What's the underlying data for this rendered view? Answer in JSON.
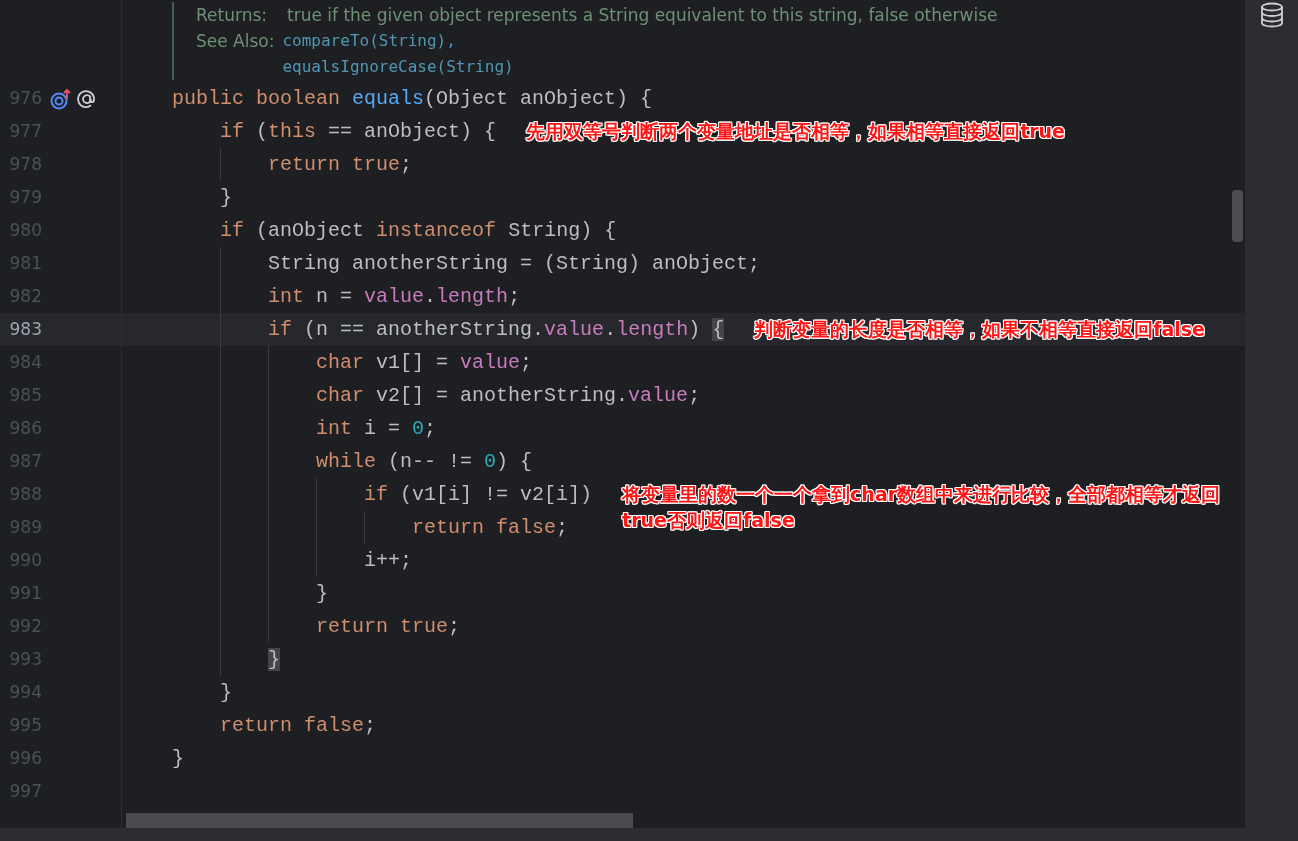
{
  "doc": {
    "returns_label": "Returns:",
    "returns_text": "true if the given object represents a String equivalent to this string, false otherwise",
    "see_also_label": "See Also:",
    "links": [
      "compareTo(String),",
      "equalsIgnoreCase(String)"
    ]
  },
  "lines": [
    {
      "number": "976",
      "current": false,
      "gutter_icons": true,
      "tokens": [
        {
          "kind": "keyword",
          "text": "    public boolean "
        },
        {
          "kind": "method",
          "text": "equals"
        },
        {
          "kind": "plain",
          "text": "(Object anObject) {"
        }
      ]
    },
    {
      "number": "977",
      "current": false,
      "tokens": [
        {
          "kind": "keyword",
          "text": "        if"
        },
        {
          "kind": "plain",
          "text": " ("
        },
        {
          "kind": "keyword",
          "text": "this"
        },
        {
          "kind": "plain",
          "text": " == anObject) {"
        }
      ],
      "note": "先用双等号判断两个变量地址是否相等，如果相等直接返回true"
    },
    {
      "number": "978",
      "current": false,
      "tokens": [
        {
          "kind": "keyword",
          "text": "            return true"
        },
        {
          "kind": "plain",
          "text": ";"
        }
      ]
    },
    {
      "number": "979",
      "current": false,
      "tokens": [
        {
          "kind": "plain",
          "text": "        }"
        }
      ]
    },
    {
      "number": "980",
      "current": false,
      "tokens": [
        {
          "kind": "keyword",
          "text": "        if"
        },
        {
          "kind": "plain",
          "text": " (anObject "
        },
        {
          "kind": "keyword",
          "text": "instanceof"
        },
        {
          "kind": "plain",
          "text": " String) {"
        }
      ]
    },
    {
      "number": "981",
      "current": false,
      "tokens": [
        {
          "kind": "plain",
          "text": "            String anotherString = (String) anObject;"
        }
      ]
    },
    {
      "number": "982",
      "current": false,
      "tokens": [
        {
          "kind": "keyword",
          "text": "            int"
        },
        {
          "kind": "plain",
          "text": " n = "
        },
        {
          "kind": "field",
          "text": "value"
        },
        {
          "kind": "plain",
          "text": "."
        },
        {
          "kind": "field",
          "text": "length"
        },
        {
          "kind": "plain",
          "text": ";"
        }
      ]
    },
    {
      "number": "983",
      "current": true,
      "tokens": [
        {
          "kind": "keyword",
          "text": "            if"
        },
        {
          "kind": "plain",
          "text": " (n == anotherString."
        },
        {
          "kind": "field",
          "text": "value"
        },
        {
          "kind": "plain",
          "text": "."
        },
        {
          "kind": "field",
          "text": "length"
        },
        {
          "kind": "plain",
          "text": ") "
        },
        {
          "kind": "match",
          "text": "{"
        }
      ],
      "note": "判断变量的长度是否相等，如果不相等直接返回false"
    },
    {
      "number": "984",
      "current": false,
      "tokens": [
        {
          "kind": "keyword",
          "text": "                char"
        },
        {
          "kind": "plain",
          "text": " v1[] = "
        },
        {
          "kind": "field",
          "text": "value"
        },
        {
          "kind": "plain",
          "text": ";"
        }
      ]
    },
    {
      "number": "985",
      "current": false,
      "tokens": [
        {
          "kind": "keyword",
          "text": "                char"
        },
        {
          "kind": "plain",
          "text": " v2[] = anotherString."
        },
        {
          "kind": "field",
          "text": "value"
        },
        {
          "kind": "plain",
          "text": ";"
        }
      ]
    },
    {
      "number": "986",
      "current": false,
      "tokens": [
        {
          "kind": "keyword",
          "text": "                int"
        },
        {
          "kind": "plain",
          "text": " i = "
        },
        {
          "kind": "number",
          "text": "0"
        },
        {
          "kind": "plain",
          "text": ";"
        }
      ]
    },
    {
      "number": "987",
      "current": false,
      "tokens": [
        {
          "kind": "keyword",
          "text": "                while"
        },
        {
          "kind": "plain",
          "text": " (n-- != "
        },
        {
          "kind": "number",
          "text": "0"
        },
        {
          "kind": "plain",
          "text": ") {"
        }
      ]
    },
    {
      "number": "988",
      "current": false,
      "tokens": [
        {
          "kind": "keyword",
          "text": "                    if"
        },
        {
          "kind": "plain",
          "text": " (v1[i] != v2[i])"
        }
      ],
      "note": "将变量里的数一个一个拿到char数组中来进行比较，全部都相等才返回true否则返回false"
    },
    {
      "number": "989",
      "current": false,
      "tokens": [
        {
          "kind": "keyword",
          "text": "                        return false"
        },
        {
          "kind": "plain",
          "text": ";"
        }
      ]
    },
    {
      "number": "990",
      "current": false,
      "tokens": [
        {
          "kind": "plain",
          "text": "                    i++;"
        }
      ]
    },
    {
      "number": "991",
      "current": false,
      "tokens": [
        {
          "kind": "plain",
          "text": "                }"
        }
      ]
    },
    {
      "number": "992",
      "current": false,
      "tokens": [
        {
          "kind": "keyword",
          "text": "                return true"
        },
        {
          "kind": "plain",
          "text": ";"
        }
      ]
    },
    {
      "number": "993",
      "current": false,
      "tokens": [
        {
          "kind": "match",
          "text": "            }"
        }
      ]
    },
    {
      "number": "994",
      "current": false,
      "tokens": [
        {
          "kind": "plain",
          "text": "        }"
        }
      ]
    },
    {
      "number": "995",
      "current": false,
      "tokens": [
        {
          "kind": "keyword",
          "text": "        return false"
        },
        {
          "kind": "plain",
          "text": ";"
        }
      ]
    },
    {
      "number": "996",
      "current": false,
      "tokens": [
        {
          "kind": "plain",
          "text": "    }"
        }
      ]
    },
    {
      "number": "997",
      "current": false
    }
  ]
}
